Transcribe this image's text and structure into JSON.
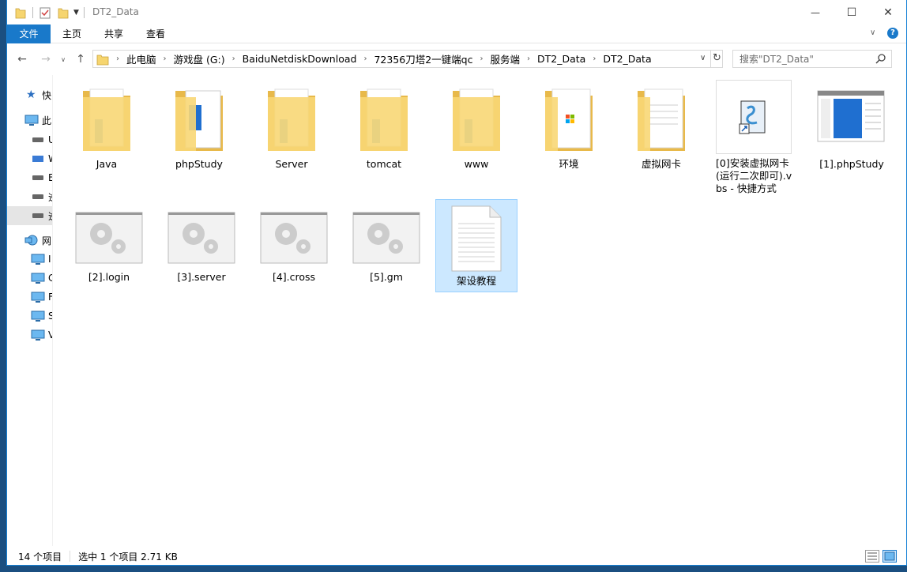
{
  "window": {
    "title": "DT2_Data",
    "controls": {
      "minimize": "—",
      "maximize": "☐",
      "close": "✕"
    }
  },
  "ribbon": {
    "tabs": [
      "文件",
      "主页",
      "共享",
      "查看"
    ]
  },
  "navbar": {
    "breadcrumbs": [
      "此电脑",
      "游戏盘 (G:)",
      "BaiduNetdiskDownload",
      "72356刀塔2一键端qc",
      "服务端",
      "DT2_Data",
      "DT2_Data"
    ],
    "search_placeholder": "搜索\"DT2_Data\""
  },
  "sidebar": {
    "items": [
      "快",
      "此",
      "U",
      "W",
      "E",
      "逆",
      "逆",
      "网",
      "I",
      "C",
      "F",
      "S",
      "V"
    ]
  },
  "items_row1": [
    {
      "label": "Java",
      "type": "folder-docs"
    },
    {
      "label": "phpStudy",
      "type": "folder-blue"
    },
    {
      "label": "Server",
      "type": "folder-docs"
    },
    {
      "label": "tomcat",
      "type": "folder-docs"
    },
    {
      "label": "www",
      "type": "folder-docs"
    },
    {
      "label": "环境",
      "type": "folder-ms"
    },
    {
      "label": "虚拟网卡",
      "type": "folder-plain"
    },
    {
      "label": "[0]安装虚拟网卡(运行二次即可).vbs - 快捷方式",
      "type": "script"
    },
    {
      "label": "[1].phpStudy",
      "type": "app-window"
    }
  ],
  "items_row2": [
    {
      "label": "[2].login",
      "type": "gear"
    },
    {
      "label": "[3].server",
      "type": "gear"
    },
    {
      "label": "[4].cross",
      "type": "gear"
    },
    {
      "label": "[5].gm",
      "type": "gear"
    },
    {
      "label": "架设教程",
      "type": "textfile"
    }
  ],
  "status": {
    "count": "14 个项目",
    "selection": "选中 1 个项目  2.71 KB"
  },
  "colors": {
    "accent": "#1979ca",
    "folder": "#f6d56f",
    "selection": "#cce8ff"
  }
}
